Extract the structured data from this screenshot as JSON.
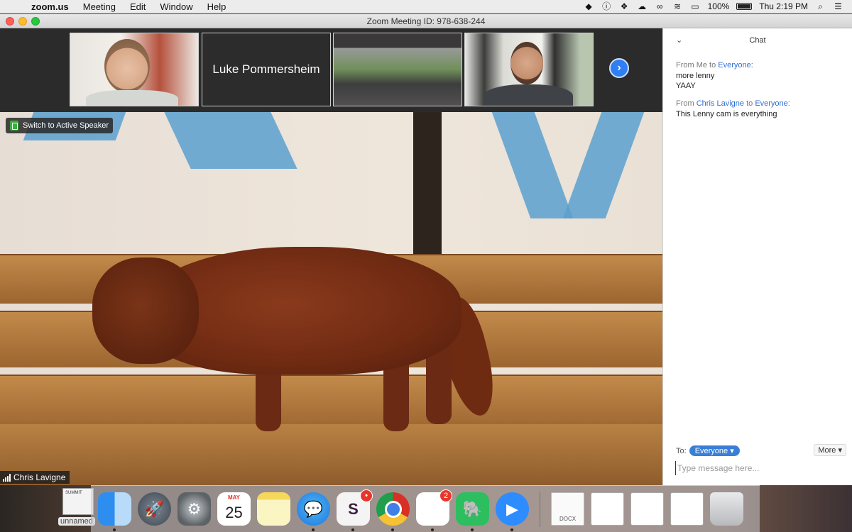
{
  "menubar": {
    "apple_icon": "apple-logo-icon",
    "app_name": "zoom.us",
    "menus": [
      "Meeting",
      "Edit",
      "Window",
      "Help"
    ],
    "battery": "100%",
    "clock": "Thu 2:19 PM"
  },
  "window": {
    "title": "Zoom Meeting ID: 978-638-244"
  },
  "gallery": {
    "participant_name_tile": "Luke Pommersheim",
    "next_icon": "chevron-right-icon"
  },
  "main_video": {
    "switch_label": "Switch to Active Speaker",
    "speaker_name": "Chris Lavigne"
  },
  "chat": {
    "title": "Chat",
    "messages": [
      {
        "from": "From Me to",
        "to": "Everyone:",
        "lines": [
          "more lenny",
          "YAAY"
        ]
      },
      {
        "from": "From",
        "sender": "Chris Lavigne",
        "to_word": "to",
        "to": "Everyone:",
        "lines": [
          "This Lenny cam is everything"
        ]
      }
    ],
    "to_label": "To:",
    "recipient": "Everyone ▾",
    "more_label": "More ▾",
    "input_placeholder": "Type message here..."
  },
  "desktop": {
    "file_label": "unnamed",
    "thumb_text": "SUMMIT"
  },
  "dock": {
    "calendar_month": "MAY",
    "calendar_day": "25",
    "slack_badge": "•",
    "reminders_badge": "2",
    "docx_label": "DOCX"
  },
  "colors": {
    "accent": "#2d8cff",
    "chat_link": "#2d6fd4",
    "to_pill": "#3a7fd6",
    "switch_green": "#36b13c"
  }
}
